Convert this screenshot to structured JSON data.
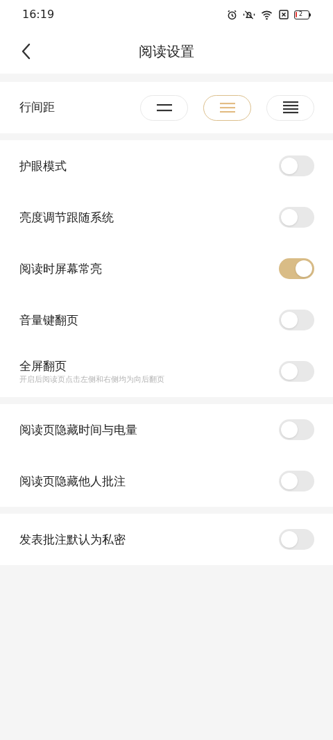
{
  "status_bar": {
    "time": "16:19",
    "battery": "2"
  },
  "header": {
    "title": "阅读设置"
  },
  "line_spacing": {
    "label": "行间距",
    "options": [
      {
        "kind": "loose",
        "selected": false
      },
      {
        "kind": "medium",
        "selected": true
      },
      {
        "kind": "tight",
        "selected": false
      }
    ]
  },
  "groups": [
    [
      {
        "label": "护眼模式",
        "on": false
      },
      {
        "label": "亮度调节跟随系统",
        "on": false
      },
      {
        "label": "阅读时屏幕常亮",
        "on": true
      },
      {
        "label": "音量键翻页",
        "on": false
      },
      {
        "label": "全屏翻页",
        "hint": "开启后阅读页点击左侧和右侧均为向后翻页",
        "on": false
      }
    ],
    [
      {
        "label": "阅读页隐藏时间与电量",
        "on": false
      },
      {
        "label": "阅读页隐藏他人批注",
        "on": false
      }
    ],
    [
      {
        "label": "发表批注默认为私密",
        "on": false
      }
    ]
  ]
}
